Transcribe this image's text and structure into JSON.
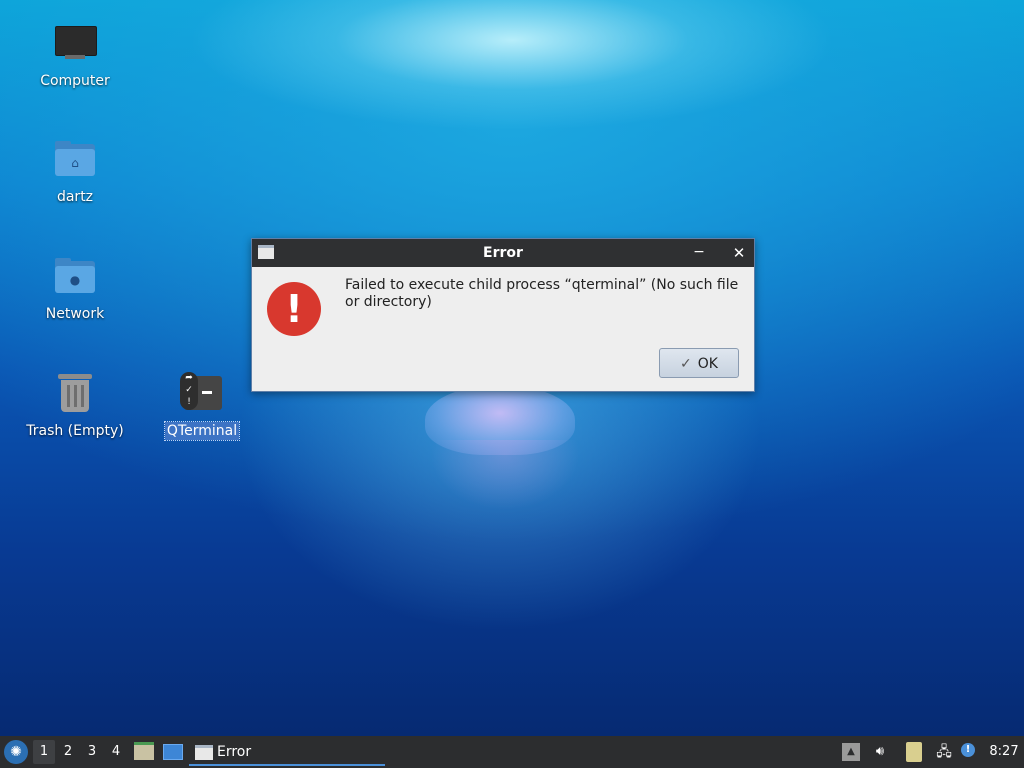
{
  "desktop": {
    "icons": [
      {
        "label": "Computer",
        "icon": "computer-icon"
      },
      {
        "label": "dartz",
        "icon": "home-folder-icon"
      },
      {
        "label": "Network",
        "icon": "network-folder-icon"
      },
      {
        "label": "Trash (Empty)",
        "icon": "trash-icon"
      },
      {
        "label": "QTerminal",
        "icon": "terminal-icon",
        "selected": true
      }
    ]
  },
  "dialog": {
    "title": "Error",
    "message": "Failed to execute child process “qterminal” (No such file or directory)",
    "ok_label": "OK",
    "minimize_glyph": "−",
    "close_glyph": "✕",
    "error_glyph": "!"
  },
  "taskbar": {
    "workspaces": [
      "1",
      "2",
      "3",
      "4"
    ],
    "active_workspace": "1",
    "task_label": "Error",
    "clock": "8:27"
  },
  "colors": {
    "accent": "#4a90d9",
    "error": "#d8382e",
    "titlebar": "#2f3032",
    "taskbar": "#2c2d2f"
  }
}
